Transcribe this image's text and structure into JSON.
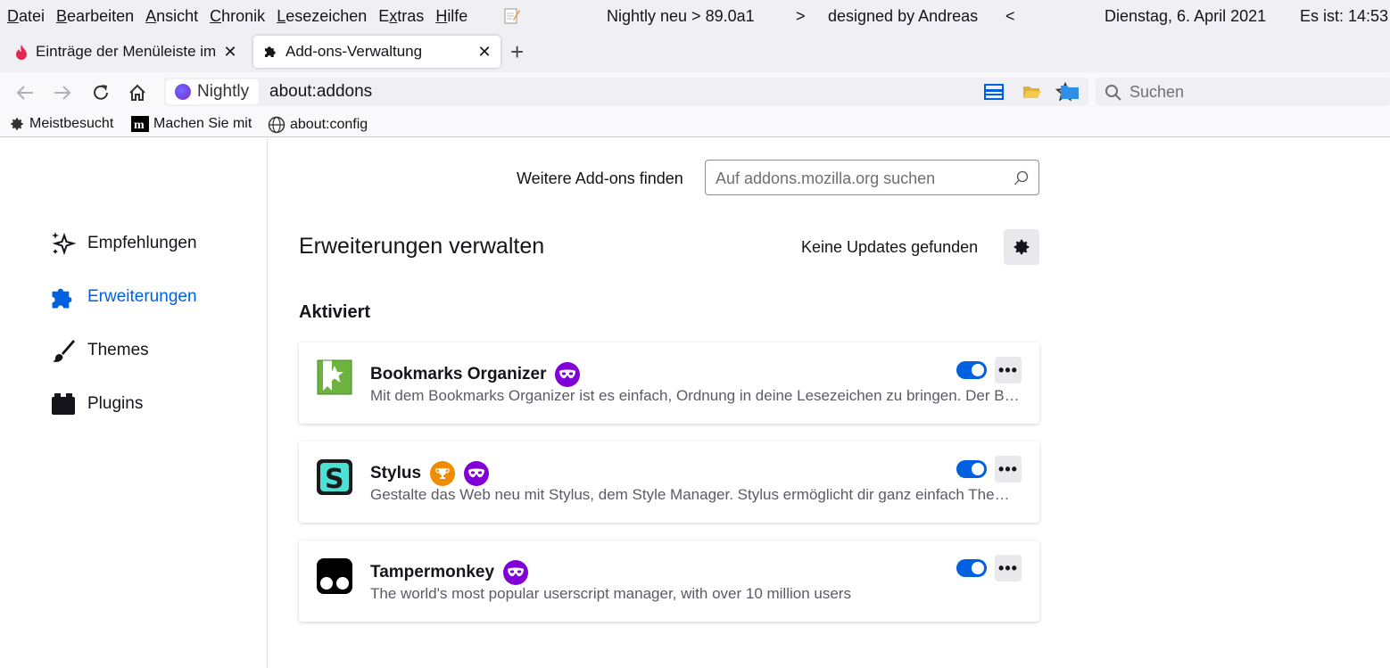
{
  "menubar": {
    "items": [
      {
        "u": "D",
        "rest": "atei"
      },
      {
        "u": "B",
        "rest": "earbeiten"
      },
      {
        "u": "A",
        "rest": "nsicht"
      },
      {
        "u": "C",
        "rest": "hronik"
      },
      {
        "u": "L",
        "rest": "esezeichen"
      },
      {
        "u": "E",
        "rest": "xtras",
        "pre": ""
      },
      {
        "u": "H",
        "rest": "ilfe"
      }
    ],
    "info_left": "Nightly neu > 89.0a1",
    "info_arrow_right": ">",
    "info_designer": "designed by Andreas",
    "info_arrow_left": "<",
    "date": "Dienstag, 6. April 2021",
    "time": "Es ist:  14:53"
  },
  "tabs": {
    "inactive_title": "Einträge der Menüleiste im",
    "active_title": "Add-ons-Verwaltung",
    "new_tab": "+"
  },
  "navbar": {
    "identity": "Nightly",
    "url": "about:addons",
    "search_placeholder": "Suchen"
  },
  "bookmarks": [
    {
      "label": "Meistbesucht",
      "icon": "gear-icon"
    },
    {
      "label": "Machen Sie mit",
      "icon": "mozilla-m-icon"
    },
    {
      "label": "about:config",
      "icon": "globe-icon"
    }
  ],
  "sidebar": {
    "categories": [
      {
        "label": "Empfehlungen",
        "icon": "sparkle-icon"
      },
      {
        "label": "Erweiterungen",
        "icon": "puzzle-icon",
        "selected": true
      },
      {
        "label": "Themes",
        "icon": "brush-icon"
      },
      {
        "label": "Plugins",
        "icon": "plugin-icon"
      }
    ]
  },
  "main": {
    "find_label": "Weitere Add-ons finden",
    "find_placeholder": "Auf addons.mozilla.org suchen",
    "heading": "Erweiterungen verwalten",
    "updates_status": "Keine Updates gefunden",
    "section_enabled": "Aktiviert",
    "addons": [
      {
        "name": "Bookmarks Organizer",
        "description": "Mit dem Bookmarks Organizer ist es einfach, Ordnung in deine Lesezeichen zu bringen. Der Bookmarks Organizer findet nicht mehr funktionierende Lesezeichen.",
        "badges": [
          "private-browsing-icon"
        ],
        "enabled": true
      },
      {
        "name": "Stylus",
        "description": "Gestalte das Web neu mit Stylus, dem Style Manager. Stylus ermöglicht dir ganz einfach Themes zu installieren.",
        "badges": [
          "recommended-trophy-icon",
          "private-browsing-icon"
        ],
        "enabled": true
      },
      {
        "name": "Tampermonkey",
        "description": "The world's most popular userscript manager, with over 10 million users",
        "badges": [
          "private-browsing-icon"
        ],
        "enabled": true
      }
    ]
  },
  "colors": {
    "accent": "#0061e0",
    "private_badge": "#8000d7",
    "recommended_badge": "#f08c00"
  }
}
